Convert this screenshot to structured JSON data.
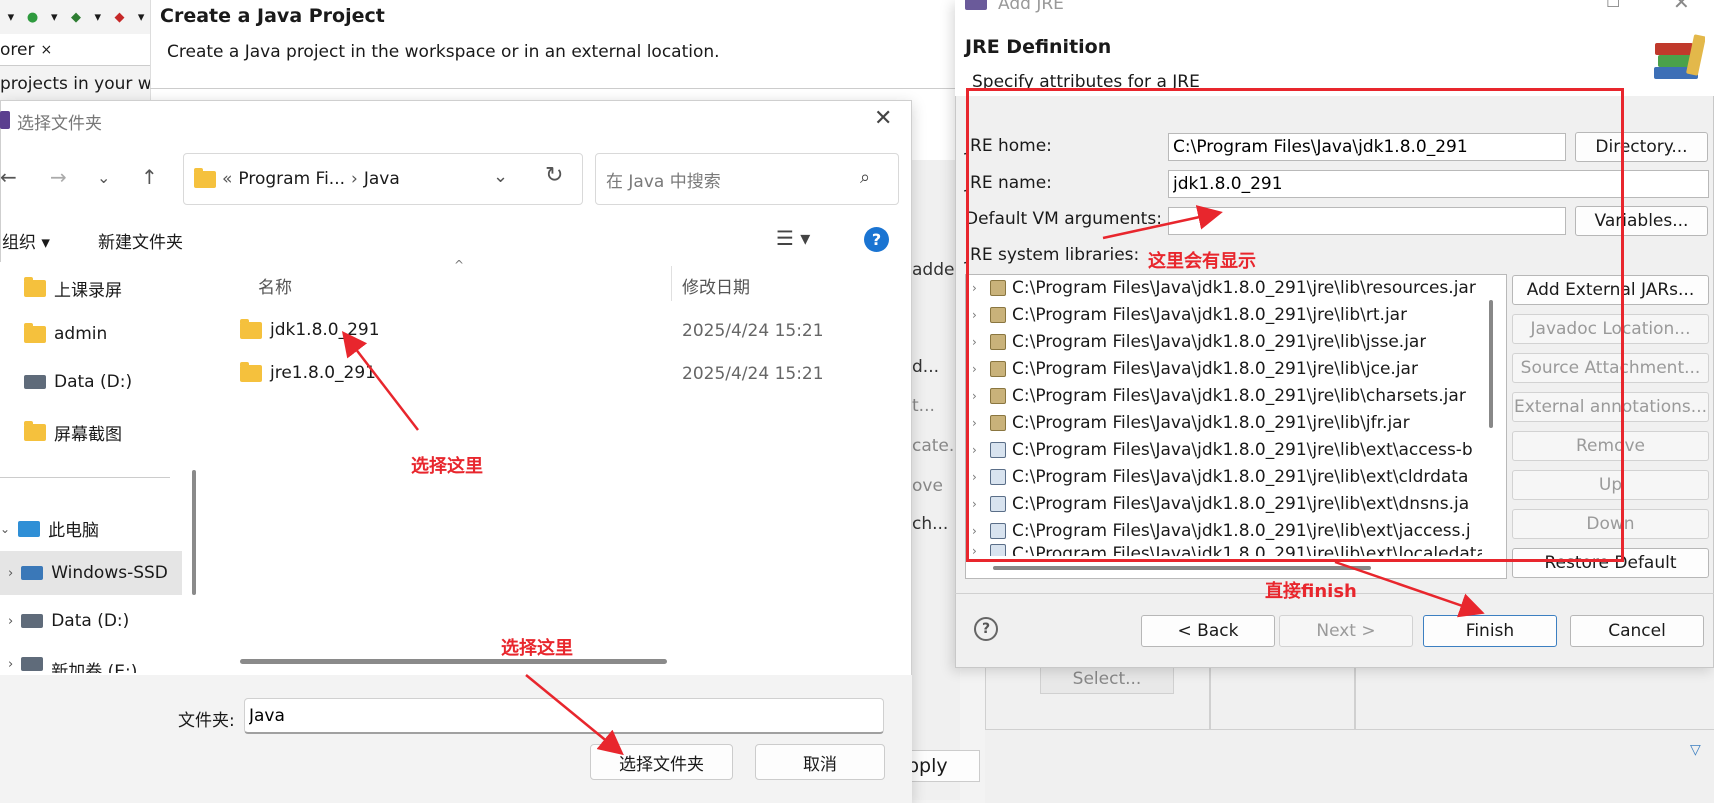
{
  "eclipse": {
    "explorer_tab": "orer",
    "explorer_close": "×",
    "projects_text": "projects in your wo",
    "wizard_title": "Create a Java Project",
    "wizard_subtitle": "Create a Java project in the workspace or in an external location.",
    "side_texts": [
      "adde",
      "d...",
      "t...",
      "cate...",
      "ove",
      "ch..."
    ],
    "lower_select": "Select...",
    "apply": "pply"
  },
  "file_dialog": {
    "title": "选择文件夹",
    "address": {
      "prefix": "«",
      "part1": "Program Fi...",
      "sep": "›",
      "part2": "Java"
    },
    "search_placeholder": "在 Java 中搜索",
    "organize": "组织 ▾",
    "new_folder": "新建文件夹",
    "nav_items": [
      {
        "label": "上课录屏",
        "icon": "folder-icon"
      },
      {
        "label": "admin",
        "icon": "folder-icon"
      },
      {
        "label": "Data (D:)",
        "icon": "drive-icon"
      },
      {
        "label": "屏幕截图",
        "icon": "folder-icon"
      }
    ],
    "this_pc": "此电脑",
    "drives": [
      "Windows-SSD",
      "Data (D:)",
      "新加卷 (E:)"
    ],
    "columns": {
      "name": "名称",
      "date": "修改日期"
    },
    "files": [
      {
        "name": "jdk1.8.0_291",
        "date": "2025/4/24 15:21"
      },
      {
        "name": "jre1.8.0_291",
        "date": "2025/4/24 15:21"
      }
    ],
    "folder_label": "文件夹:",
    "folder_value": "Java",
    "select_button": "选择文件夹",
    "cancel_button": "取消"
  },
  "jre_dialog": {
    "window_title": "Add JRE",
    "heading": "JRE Definition",
    "subheading": "Specify attributes for a JRE",
    "jre_home_label": "JRE home:",
    "jre_home_value": "C:\\Program Files\\Java\\jdk1.8.0_291",
    "directory_button": "Directory...",
    "jre_name_label": "JRE name:",
    "jre_name_value": "jdk1.8.0_291",
    "vm_args_label": "Default VM arguments:",
    "vm_args_value": "",
    "variables_button": "Variables...",
    "libs_label": "JRE system libraries:",
    "libraries": [
      "C:\\Program Files\\Java\\jdk1.8.0_291\\jre\\lib\\resources.jar",
      "C:\\Program Files\\Java\\jdk1.8.0_291\\jre\\lib\\rt.jar",
      "C:\\Program Files\\Java\\jdk1.8.0_291\\jre\\lib\\jsse.jar",
      "C:\\Program Files\\Java\\jdk1.8.0_291\\jre\\lib\\jce.jar",
      "C:\\Program Files\\Java\\jdk1.8.0_291\\jre\\lib\\charsets.jar",
      "C:\\Program Files\\Java\\jdk1.8.0_291\\jre\\lib\\jfr.jar",
      "C:\\Program Files\\Java\\jdk1.8.0_291\\jre\\lib\\ext\\access-b",
      "C:\\Program Files\\Java\\jdk1.8.0_291\\jre\\lib\\ext\\cldrdata",
      "C:\\Program Files\\Java\\jdk1.8.0_291\\jre\\lib\\ext\\dnsns.ja",
      "C:\\Program Files\\Java\\jdk1.8.0_291\\jre\\lib\\ext\\jaccess.j",
      "C:\\Program Files\\Java\\jdk1.8.0_291\\jre\\lib\\ext\\localedata"
    ],
    "side_buttons": {
      "add_external_jars": "Add External JARs...",
      "javadoc_location": "Javadoc Location...",
      "source_attachment": "Source Attachment...",
      "external_annotations": "External annotations...",
      "remove": "Remove",
      "up": "Up",
      "down": "Down",
      "restore_default": "Restore Default"
    },
    "back_button": "< Back",
    "next_button": "Next >",
    "finish_button": "Finish",
    "cancel_button": "Cancel",
    "help": "?"
  },
  "annotations": {
    "select_here_1": "选择这里",
    "select_here_2": "选择这里",
    "will_show_here": "这里会有显示",
    "direct_finish": "直接finish"
  },
  "colors": {
    "annotation_red": "#e8262d",
    "accent_blue": "#1a74d2",
    "folder_yellow": "#f5c13d"
  }
}
